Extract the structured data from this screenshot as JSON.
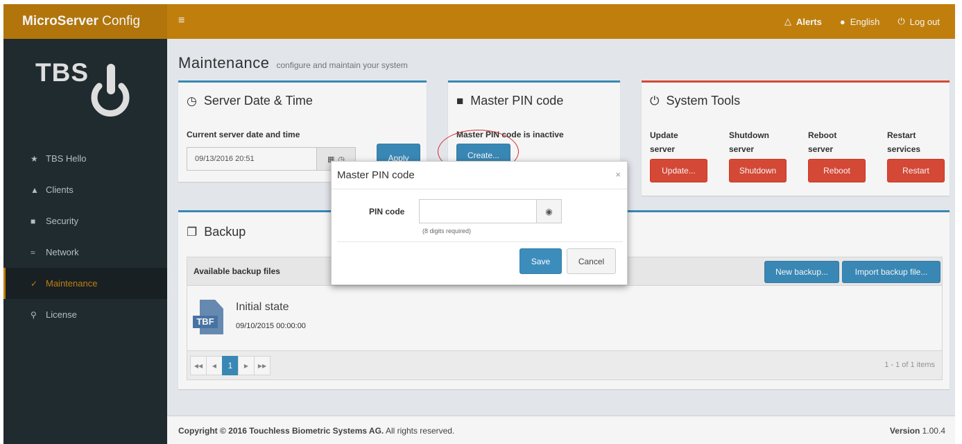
{
  "app": {
    "brand_bold": "MicroServer",
    "brand_rest": " Config",
    "logo_text": "TBS"
  },
  "topbar": {
    "menu_icon": "bars-icon",
    "alerts": "Alerts",
    "language": "English",
    "logout": "Log out"
  },
  "sidebar": {
    "items": [
      {
        "label": "TBS Hello",
        "icon": "star-icon"
      },
      {
        "label": "Clients",
        "icon": "sitemap-icon"
      },
      {
        "label": "Security",
        "icon": "lock-icon"
      },
      {
        "label": "Network",
        "icon": "wifi-icon"
      },
      {
        "label": "Maintenance",
        "icon": "wrench-icon",
        "active": true
      },
      {
        "label": "License",
        "icon": "key-icon"
      }
    ]
  },
  "page": {
    "title": "Maintenance",
    "subtitle": "configure and maintain your system"
  },
  "date_box": {
    "title": "Server Date & Time",
    "label": "Current server date and time",
    "value": "09/13/2016 20:51",
    "apply": "Apply"
  },
  "pin_box": {
    "title": "Master PIN code",
    "status": "Master PIN code is inactive",
    "create": "Create..."
  },
  "tools_box": {
    "title": "System Tools",
    "columns": [
      {
        "l1": "Update",
        "l2": "server",
        "button": "Update..."
      },
      {
        "l1": "Shutdown",
        "l2": "server",
        "button": "Shutdown"
      },
      {
        "l1": "Reboot",
        "l2": "server",
        "button": "Reboot"
      },
      {
        "l1": "Restart",
        "l2": "services",
        "button": "Restart"
      }
    ]
  },
  "backup": {
    "title": "Backup",
    "header": "Available backup files",
    "new_backup": "New backup...",
    "import": "Import backup file...",
    "file": {
      "tag": "TBF",
      "name": "Initial state",
      "date": "09/10/2015 00:00:00"
    },
    "pager": {
      "current": "1",
      "info": "1 - 1 of 1 items"
    }
  },
  "footer": {
    "copyright_bold": "Copyright © 2016 Touchless Biometric Systems AG.",
    "copyright_rest": " All rights reserved.",
    "version_label": "Version",
    "version": "1.00.4"
  },
  "modal": {
    "title": "Master PIN code",
    "pin_label": "PIN code",
    "pin_value": "",
    "help": "(8 digits required)",
    "save": "Save",
    "cancel": "Cancel"
  },
  "colors": {
    "accent": "#c8850e",
    "sidebar": "#222d32",
    "primary": "#3c8dbc",
    "danger": "#dd4b39"
  }
}
